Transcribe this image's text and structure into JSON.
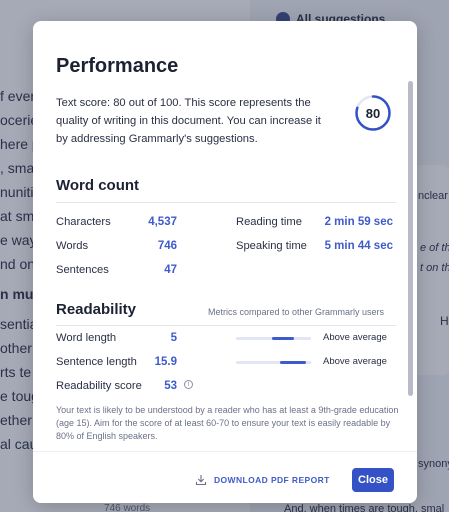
{
  "background": {
    "suggestions_label": "All suggestions",
    "lines": [
      "f ever",
      "ocerie",
      "here p",
      ", smar",
      "nunitie",
      "at sm",
      "e way",
      "nd on",
      "n mult",
      "sentia",
      "other ",
      "rts te",
      "e toug",
      "ether ",
      "al cau"
    ],
    "right_fragments": [
      "nclear",
      "e of th",
      "t on th",
      "H",
      "synony"
    ],
    "word_count_footer": "746 words",
    "bottom_text": "And, when times are tough, smal"
  },
  "modal": {
    "performance": {
      "title": "Performance",
      "text": "Text score: 80 out of 100. This score represents the quality of writing in this document. You can increase it by addressing Grammarly's suggestions.",
      "score": "80",
      "score_fraction": 0.8
    },
    "word_count": {
      "title": "Word count",
      "characters_label": "Characters",
      "characters_value": "4,537",
      "words_label": "Words",
      "words_value": "746",
      "sentences_label": "Sentences",
      "sentences_value": "47",
      "reading_time_label": "Reading time",
      "reading_time_value": "2 min 59 sec",
      "speaking_time_label": "Speaking time",
      "speaking_time_value": "5 min 44 sec"
    },
    "readability": {
      "title": "Readability",
      "note": "Metrics compared to other Grammarly users",
      "word_length_label": "Word length",
      "word_length_value": "5",
      "word_length_rating": "Above average",
      "sentence_length_label": "Sentence length",
      "sentence_length_value": "15.9",
      "sentence_length_rating": "Above average",
      "score_label": "Readability score",
      "score_value": "53",
      "info_icon": "i",
      "description": "Your text is likely to be understood by a reader who has at least a 9th-grade education (age 15). Aim for the score of at least 60-70 to ensure your text is easily readable by 80% of English speakers."
    },
    "footer": {
      "download_label": "DOWNLOAD PDF REPORT",
      "close_label": "Close"
    }
  }
}
